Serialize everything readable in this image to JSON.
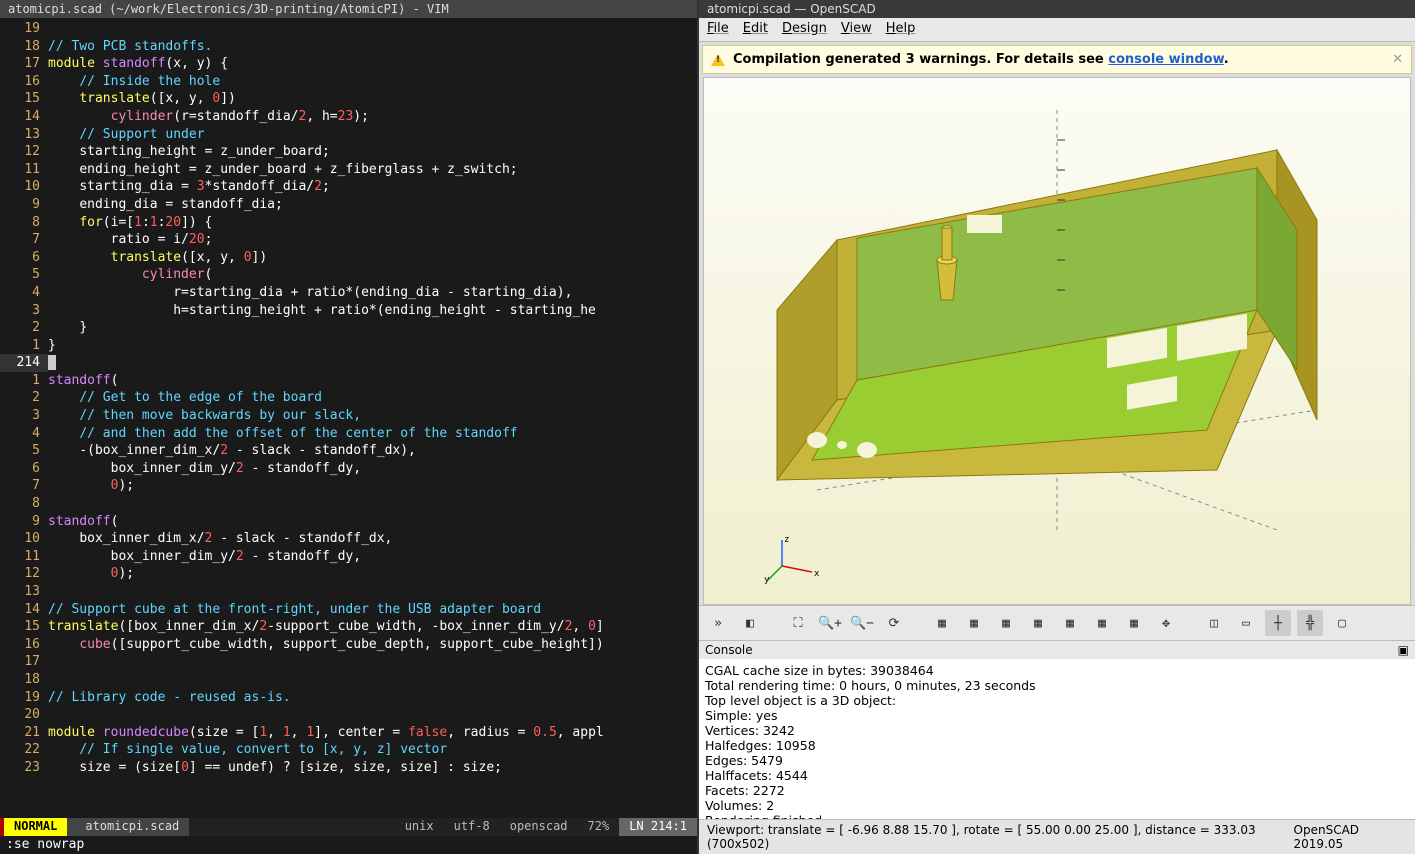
{
  "vim": {
    "title": "atomicpi.scad (~/work/Electronics/3D-printing/AtomicPI) - VIM",
    "status": {
      "mode": "NORMAL",
      "file": "atomicpi.scad",
      "enc1": "unix",
      "enc2": "utf-8",
      "ft": "openscad",
      "pct": "72%",
      "pos": "LN 214:1"
    },
    "cmdline": ":se nowrap",
    "lines": [
      {
        "n": "19",
        "html": ""
      },
      {
        "n": "18",
        "html": "<span class='c-comment'>// Two PCB standoffs.</span>"
      },
      {
        "n": "17",
        "html": "<span class='c-keyword'>module</span> <span class='c-func'>standoff</span><span class='c-plain'>(x, y) {</span>"
      },
      {
        "n": "16",
        "html": "    <span class='c-comment'>// Inside the hole</span>"
      },
      {
        "n": "15",
        "html": "    <span class='c-keyword'>translate</span><span class='c-plain'>([x, y, </span><span class='c-number'>0</span><span class='c-plain'>])</span>"
      },
      {
        "n": "14",
        "html": "        <span class='c-builtin'>cylinder</span><span class='c-plain'>(r=standoff_dia/</span><span class='c-number'>2</span><span class='c-plain'>, h=</span><span class='c-number'>23</span><span class='c-plain'>);</span>"
      },
      {
        "n": "13",
        "html": "    <span class='c-comment'>// Support under</span>"
      },
      {
        "n": "12",
        "html": "    <span class='c-plain'>starting_height</span> <span class='c-ident'>=</span> <span class='c-plain'>z_under_board;</span>"
      },
      {
        "n": "11",
        "html": "    <span class='c-plain'>ending_height</span> <span class='c-ident'>=</span> <span class='c-plain'>z_under_board + z_fiberglass + z_switch;</span>"
      },
      {
        "n": "10",
        "html": "    <span class='c-plain'>starting_dia</span> <span class='c-ident'>=</span> <span class='c-number'>3</span><span class='c-plain'>*standoff_dia/</span><span class='c-number'>2</span><span class='c-plain'>;</span>"
      },
      {
        "n": "9",
        "html": "    <span class='c-plain'>ending_dia</span> <span class='c-ident'>=</span> <span class='c-plain'>standoff_dia;</span>"
      },
      {
        "n": "8",
        "html": "    <span class='c-keyword'>for</span><span class='c-plain'>(i=[</span><span class='c-number'>1</span><span class='c-plain'>:</span><span class='c-number'>1</span><span class='c-plain'>:</span><span class='c-number'>20</span><span class='c-plain'>]) {</span>"
      },
      {
        "n": "7",
        "html": "        <span class='c-plain'>ratio</span> <span class='c-ident'>=</span> <span class='c-plain'>i/</span><span class='c-number'>20</span><span class='c-plain'>;</span>"
      },
      {
        "n": "6",
        "html": "        <span class='c-keyword'>translate</span><span class='c-plain'>([x, y, </span><span class='c-number'>0</span><span class='c-plain'>])</span>"
      },
      {
        "n": "5",
        "html": "            <span class='c-builtin'>cylinder</span><span class='c-plain'>(</span>"
      },
      {
        "n": "4",
        "html": "                <span class='c-plain'>r=starting_dia + ratio*(ending_dia - starting_dia),</span>"
      },
      {
        "n": "3",
        "html": "                <span class='c-plain'>h=starting_height + ratio*(ending_height - starting_he</span>"
      },
      {
        "n": "2",
        "html": "    <span class='c-plain'>}</span>"
      },
      {
        "n": "1",
        "html": "<span class='c-plain'>}</span>"
      },
      {
        "n": "214",
        "current": true,
        "html": "<span class='cursor-block'> </span>"
      },
      {
        "n": "1",
        "html": "<span class='c-func'>standoff</span><span class='c-plain'>(</span>"
      },
      {
        "n": "2",
        "html": "    <span class='c-comment'>// Get to the edge of the board</span>"
      },
      {
        "n": "3",
        "html": "    <span class='c-comment'>// then move backwards by our slack,</span>"
      },
      {
        "n": "4",
        "html": "    <span class='c-comment'>// and then add the offset of the center of the standoff</span>"
      },
      {
        "n": "5",
        "html": "    <span class='c-plain'>-(box_inner_dim_x/</span><span class='c-number'>2</span><span class='c-plain'> - slack - standoff_dx),</span>"
      },
      {
        "n": "6",
        "html": "        <span class='c-plain'>box_inner_dim_y/</span><span class='c-number'>2</span><span class='c-plain'> - standoff_dy,</span>"
      },
      {
        "n": "7",
        "html": "        <span class='c-number'>0</span><span class='c-plain'>);</span>"
      },
      {
        "n": "8",
        "html": ""
      },
      {
        "n": "9",
        "html": "<span class='c-func'>standoff</span><span class='c-plain'>(</span>"
      },
      {
        "n": "10",
        "html": "    <span class='c-plain'>box_inner_dim_x/</span><span class='c-number'>2</span><span class='c-plain'> - slack - standoff_dx,</span>"
      },
      {
        "n": "11",
        "html": "        <span class='c-plain'>box_inner_dim_y/</span><span class='c-number'>2</span><span class='c-plain'> - standoff_dy,</span>"
      },
      {
        "n": "12",
        "html": "        <span class='c-number'>0</span><span class='c-plain'>);</span>"
      },
      {
        "n": "13",
        "html": ""
      },
      {
        "n": "14",
        "html": "<span class='c-comment'>// Support cube at the front-right, under the USB adapter board</span>"
      },
      {
        "n": "15",
        "html": "<span class='c-keyword'>translate</span><span class='c-plain'>([box_inner_dim_x/</span><span class='c-number'>2</span><span class='c-plain'>-support_cube_width, -box_inner_dim_y/</span><span class='c-number'>2</span><span class='c-plain'>, </span><span class='c-number'>0</span><span class='c-plain'>]</span>"
      },
      {
        "n": "16",
        "html": "    <span class='c-builtin'>cube</span><span class='c-plain'>([support_cube_width, support_cube_depth, support_cube_height])</span>"
      },
      {
        "n": "17",
        "html": ""
      },
      {
        "n": "18",
        "html": ""
      },
      {
        "n": "19",
        "html": "<span class='c-comment'>// Library code - reused as-is.</span>"
      },
      {
        "n": "20",
        "html": ""
      },
      {
        "n": "21",
        "html": "<span class='c-keyword'>module</span> <span class='c-func'>roundedcube</span><span class='c-plain'>(size = [</span><span class='c-number'>1</span><span class='c-plain'>, </span><span class='c-number'>1</span><span class='c-plain'>, </span><span class='c-number'>1</span><span class='c-plain'>], center = </span><span class='c-bool'>false</span><span class='c-plain'>, radius = </span><span class='c-number'>0.5</span><span class='c-plain'>, appl</span>"
      },
      {
        "n": "22",
        "html": "    <span class='c-comment'>// If single value, convert to [x, y, z] vector</span>"
      },
      {
        "n": "23",
        "html": "    <span class='c-plain'>size</span> <span class='c-ident'>=</span> <span class='c-plain'>(size[</span><span class='c-number'>0</span><span class='c-plain'>] == undef) ? [size, size, size] : size;</span>"
      }
    ]
  },
  "scad": {
    "title": "atomicpi.scad — OpenSCAD",
    "menus": [
      "File",
      "Edit",
      "Design",
      "View",
      "Help"
    ],
    "warning": {
      "icon": "warning-icon",
      "text1": "Compilation generated 3 warnings. For details see ",
      "link": "console window",
      "text2": "."
    },
    "toolbar_icons": [
      "expand",
      "cube-preview",
      "zoom-fit",
      "zoom-in",
      "zoom-out",
      "rotate",
      "view-right",
      "view-top",
      "view-bottom",
      "view-left",
      "view-front",
      "view-back",
      "view-diagonal",
      "center",
      "perspective",
      "orthogonal",
      "axes",
      "axes-ticks",
      "crosshair"
    ],
    "console_title": "Console",
    "console": [
      "CGAL cache size in bytes: 39038464",
      "Total rendering time: 0 hours, 0 minutes, 23 seconds",
      "Top level object is a 3D object:",
      "Simple:        yes",
      "Vertices:     3242",
      "Halfedges:   10958",
      "Edges:        5479",
      "Halffacets:   4544",
      "Facets:       2272",
      "Volumes:         2",
      "Rendering finished."
    ],
    "status_left": "Viewport: translate = [ -6.96 8.88 15.70 ], rotate = [ 55.00 0.00 25.00 ], distance = 333.03 (700x502)",
    "status_right": "OpenSCAD 2019.05"
  }
}
